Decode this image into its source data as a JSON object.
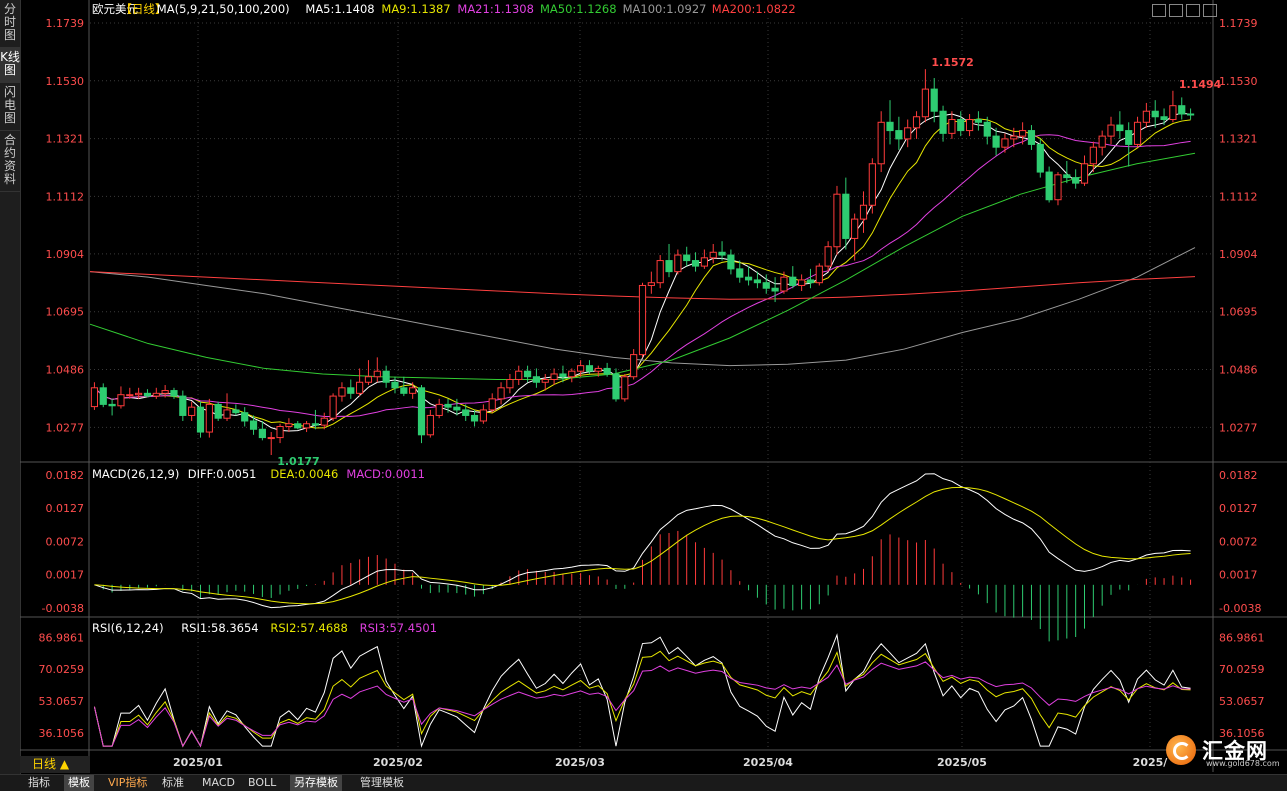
{
  "sidebar": [
    {
      "label": "分时图",
      "active": false
    },
    {
      "label": "K线图",
      "active": true
    },
    {
      "label": "闪电图",
      "active": false
    },
    {
      "label": "合约资料",
      "active": false
    }
  ],
  "main_legend": {
    "symbol": "欧元美元",
    "period": "【日线】",
    "icon": "gear-icon",
    "items": [
      {
        "text": "MA(5,9,21,50,100,200)",
        "color": "#ffffff"
      },
      {
        "text": "MA5:1.1408",
        "color": "#ffffff"
      },
      {
        "text": "MA9:1.1387",
        "color": "#e6e600"
      },
      {
        "text": "MA21:1.1308",
        "color": "#e040e0"
      },
      {
        "text": "MA50:1.1268",
        "color": "#33cc33"
      },
      {
        "text": "MA100:1.0927",
        "color": "#999999"
      },
      {
        "text": "MA200:1.0822",
        "color": "#ff4040"
      }
    ]
  },
  "price_axis": [
    "1.1739",
    "1.1530",
    "1.1321",
    "1.1112",
    "1.0904",
    "1.0695",
    "1.0486",
    "1.0277"
  ],
  "annotations": {
    "high": "1.1572",
    "low": "1.0177",
    "recent_high": "1.1494"
  },
  "macd_legend": [
    {
      "text": "MACD(26,12,9)",
      "color": "#ffffff"
    },
    {
      "text": "DIFF:0.0051",
      "color": "#ffffff"
    },
    {
      "text": "DEA:0.0046",
      "color": "#e6e600"
    },
    {
      "text": "MACD:0.0011",
      "color": "#e040e0"
    }
  ],
  "macd_axis": [
    "0.0182",
    "0.0127",
    "0.0072",
    "0.0017",
    "-0.0038"
  ],
  "rsi_legend": [
    {
      "text": "RSI(6,12,24)",
      "color": "#ffffff"
    },
    {
      "text": "RSI1:58.3654",
      "color": "#ffffff"
    },
    {
      "text": "RSI2:57.4688",
      "color": "#e6e600"
    },
    {
      "text": "RSI3:57.4501",
      "color": "#e040e0"
    }
  ],
  "rsi_axis": [
    "86.9861",
    "70.0259",
    "53.0657",
    "36.1056"
  ],
  "time_axis": [
    "2025/01",
    "2025/02",
    "2025/03",
    "2025/04",
    "2025/05",
    "2025/"
  ],
  "day_button": "日线 ▲",
  "bottom_tabs": [
    {
      "label": "指标",
      "style": "normal"
    },
    {
      "label": "模板",
      "style": "active"
    },
    {
      "label": "VIP指标",
      "style": "vip"
    },
    {
      "label": "标准",
      "style": "normal"
    },
    {
      "label": "MACD",
      "style": "normal"
    },
    {
      "label": "BOLL",
      "style": "normal"
    },
    {
      "label": "另存模板",
      "style": "active"
    },
    {
      "label": "管理模板",
      "style": "normal"
    }
  ],
  "logo": {
    "name": "汇金网",
    "url": "www.gold678.com"
  },
  "colors": {
    "up": "#ff3b3b",
    "down": "#2ecc71",
    "axis_text": "#ff4d4d",
    "grid": "#3a3a3a"
  },
  "chart_data": {
    "type": "candlestick",
    "period": "daily",
    "y_range": [
      1.0177,
      1.1739
    ],
    "extremes": {
      "high": 1.1572,
      "low": 1.0177,
      "recent_high": 1.1494
    },
    "ohlc": [
      [
        1.0352,
        1.044,
        1.034,
        1.042
      ],
      [
        1.042,
        1.0436,
        1.035,
        1.036
      ],
      [
        1.036,
        1.038,
        1.032,
        1.0355
      ],
      [
        1.0355,
        1.0425,
        1.0345,
        1.0395
      ],
      [
        1.0395,
        1.042,
        1.038,
        1.0395
      ],
      [
        1.0395,
        1.042,
        1.038,
        1.04
      ],
      [
        1.04,
        1.0415,
        1.0385,
        1.039
      ],
      [
        1.039,
        1.042,
        1.038,
        1.04
      ],
      [
        1.04,
        1.043,
        1.0385,
        1.041
      ],
      [
        1.041,
        1.042,
        1.038,
        1.039
      ],
      [
        1.039,
        1.041,
        1.03,
        1.032
      ],
      [
        1.032,
        1.037,
        1.03,
        1.035
      ],
      [
        1.035,
        1.037,
        1.024,
        1.026
      ],
      [
        1.026,
        1.038,
        1.024,
        1.036
      ],
      [
        1.036,
        1.037,
        1.03,
        1.031
      ],
      [
        1.031,
        1.04,
        1.03,
        1.034
      ],
      [
        1.034,
        1.036,
        1.032,
        1.033
      ],
      [
        1.033,
        1.035,
        1.028,
        1.03
      ],
      [
        1.03,
        1.032,
        1.025,
        1.027
      ],
      [
        1.027,
        1.03,
        1.023,
        1.024
      ],
      [
        1.024,
        1.026,
        1.0177,
        1.024
      ],
      [
        1.024,
        1.029,
        1.022,
        1.028
      ],
      [
        1.028,
        1.031,
        1.026,
        1.029
      ],
      [
        1.029,
        1.03,
        1.027,
        1.0275
      ],
      [
        1.0275,
        1.03,
        1.026,
        1.029
      ],
      [
        1.029,
        1.034,
        1.027,
        1.0285
      ],
      [
        1.0285,
        1.033,
        1.027,
        1.031
      ],
      [
        1.031,
        1.04,
        1.03,
        1.039
      ],
      [
        1.039,
        1.044,
        1.037,
        1.042
      ],
      [
        1.042,
        1.045,
        1.038,
        1.04
      ],
      [
        1.04,
        1.049,
        1.039,
        1.044
      ],
      [
        1.044,
        1.052,
        1.043,
        1.046
      ],
      [
        1.046,
        1.053,
        1.044,
        1.048
      ],
      [
        1.048,
        1.05,
        1.042,
        1.044
      ],
      [
        1.044,
        1.046,
        1.04,
        1.042
      ],
      [
        1.042,
        1.046,
        1.039,
        1.04
      ],
      [
        1.04,
        1.044,
        1.038,
        1.042
      ],
      [
        1.042,
        1.043,
        1.022,
        1.025
      ],
      [
        1.025,
        1.034,
        1.024,
        1.032
      ],
      [
        1.032,
        1.038,
        1.031,
        1.036
      ],
      [
        1.036,
        1.038,
        1.033,
        1.035
      ],
      [
        1.035,
        1.038,
        1.032,
        1.034
      ],
      [
        1.034,
        1.036,
        1.03,
        1.032
      ],
      [
        1.032,
        1.034,
        1.028,
        1.03
      ],
      [
        1.03,
        1.036,
        1.029,
        1.034
      ],
      [
        1.034,
        1.04,
        1.033,
        1.038
      ],
      [
        1.038,
        1.044,
        1.036,
        1.042
      ],
      [
        1.042,
        1.047,
        1.04,
        1.045
      ],
      [
        1.045,
        1.05,
        1.043,
        1.048
      ],
      [
        1.048,
        1.05,
        1.044,
        1.046
      ],
      [
        1.046,
        1.049,
        1.042,
        1.044
      ],
      [
        1.044,
        1.047,
        1.041,
        1.045
      ],
      [
        1.045,
        1.049,
        1.043,
        1.047
      ],
      [
        1.047,
        1.05,
        1.044,
        1.046
      ],
      [
        1.046,
        1.049,
        1.044,
        1.048
      ],
      [
        1.048,
        1.052,
        1.046,
        1.05
      ],
      [
        1.05,
        1.052,
        1.047,
        1.048
      ],
      [
        1.048,
        1.05,
        1.046,
        1.049
      ],
      [
        1.049,
        1.051,
        1.046,
        1.047
      ],
      [
        1.047,
        1.049,
        1.037,
        1.038
      ],
      [
        1.038,
        1.047,
        1.037,
        1.046
      ],
      [
        1.046,
        1.056,
        1.045,
        1.054
      ],
      [
        1.054,
        1.08,
        1.053,
        1.079
      ],
      [
        1.079,
        1.084,
        1.076,
        1.08
      ],
      [
        1.08,
        1.09,
        1.078,
        1.088
      ],
      [
        1.088,
        1.094,
        1.082,
        1.084
      ],
      [
        1.084,
        1.092,
        1.083,
        1.09
      ],
      [
        1.09,
        1.093,
        1.086,
        1.088
      ],
      [
        1.088,
        1.091,
        1.084,
        1.086
      ],
      [
        1.086,
        1.092,
        1.085,
        1.089
      ],
      [
        1.089,
        1.094,
        1.087,
        1.091
      ],
      [
        1.091,
        1.095,
        1.088,
        1.09
      ],
      [
        1.09,
        1.092,
        1.083,
        1.085
      ],
      [
        1.085,
        1.088,
        1.08,
        1.082
      ],
      [
        1.082,
        1.086,
        1.079,
        1.081
      ],
      [
        1.081,
        1.084,
        1.078,
        1.08
      ],
      [
        1.08,
        1.083,
        1.076,
        1.078
      ],
      [
        1.078,
        1.082,
        1.073,
        1.077
      ],
      [
        1.077,
        1.084,
        1.076,
        1.082
      ],
      [
        1.082,
        1.086,
        1.078,
        1.079
      ],
      [
        1.079,
        1.083,
        1.077,
        1.081
      ],
      [
        1.081,
        1.085,
        1.078,
        1.08
      ],
      [
        1.08,
        1.087,
        1.079,
        1.086
      ],
      [
        1.086,
        1.095,
        1.084,
        1.093
      ],
      [
        1.093,
        1.115,
        1.09,
        1.112
      ],
      [
        1.112,
        1.118,
        1.092,
        1.096
      ],
      [
        1.096,
        1.105,
        1.088,
        1.103
      ],
      [
        1.103,
        1.113,
        1.098,
        1.108
      ],
      [
        1.108,
        1.125,
        1.105,
        1.123
      ],
      [
        1.123,
        1.142,
        1.12,
        1.138
      ],
      [
        1.138,
        1.146,
        1.13,
        1.135
      ],
      [
        1.135,
        1.14,
        1.128,
        1.132
      ],
      [
        1.132,
        1.139,
        1.129,
        1.136
      ],
      [
        1.136,
        1.142,
        1.132,
        1.14
      ],
      [
        1.14,
        1.1572,
        1.138,
        1.15
      ],
      [
        1.15,
        1.154,
        1.138,
        1.142
      ],
      [
        1.142,
        1.144,
        1.131,
        1.134
      ],
      [
        1.134,
        1.142,
        1.132,
        1.139
      ],
      [
        1.139,
        1.142,
        1.133,
        1.135
      ],
      [
        1.135,
        1.141,
        1.133,
        1.139
      ],
      [
        1.139,
        1.142,
        1.135,
        1.138
      ],
      [
        1.138,
        1.14,
        1.13,
        1.133
      ],
      [
        1.133,
        1.136,
        1.126,
        1.129
      ],
      [
        1.129,
        1.134,
        1.127,
        1.132
      ],
      [
        1.132,
        1.136,
        1.129,
        1.133
      ],
      [
        1.133,
        1.138,
        1.13,
        1.135
      ],
      [
        1.135,
        1.137,
        1.128,
        1.13
      ],
      [
        1.13,
        1.132,
        1.118,
        1.12
      ],
      [
        1.12,
        1.122,
        1.109,
        1.11
      ],
      [
        1.11,
        1.12,
        1.108,
        1.119
      ],
      [
        1.119,
        1.124,
        1.116,
        1.118
      ],
      [
        1.118,
        1.121,
        1.114,
        1.116
      ],
      [
        1.116,
        1.126,
        1.115,
        1.123
      ],
      [
        1.123,
        1.131,
        1.12,
        1.129
      ],
      [
        1.129,
        1.135,
        1.126,
        1.133
      ],
      [
        1.133,
        1.14,
        1.13,
        1.137
      ],
      [
        1.137,
        1.142,
        1.132,
        1.135
      ],
      [
        1.135,
        1.138,
        1.122,
        1.13
      ],
      [
        1.13,
        1.14,
        1.129,
        1.138
      ],
      [
        1.138,
        1.145,
        1.136,
        1.142
      ],
      [
        1.142,
        1.146,
        1.136,
        1.14
      ],
      [
        1.14,
        1.143,
        1.137,
        1.139
      ],
      [
        1.139,
        1.1494,
        1.138,
        1.144
      ],
      [
        1.144,
        1.147,
        1.139,
        1.141
      ],
      [
        1.141,
        1.143,
        1.139,
        1.1408
      ]
    ],
    "moving_averages": [
      {
        "name": "MA100",
        "values": [
          1.084,
          1.082,
          1.079,
          1.076,
          1.072,
          1.068,
          1.064,
          1.06,
          1.056,
          1.053,
          1.051,
          1.05,
          1.0505,
          1.052,
          1.056,
          1.062,
          1.067,
          1.074,
          1.082,
          1.0927
        ]
      },
      {
        "name": "MA200",
        "values": [
          1.084,
          1.083,
          1.082,
          1.081,
          1.08,
          1.079,
          1.078,
          1.077,
          1.076,
          1.0752,
          1.0745,
          1.074,
          1.0742,
          1.0748,
          1.0758,
          1.077,
          1.0785,
          1.08,
          1.0812,
          1.0822
        ]
      },
      {
        "name": "MA50",
        "values": [
          1.065,
          1.058,
          1.053,
          1.049,
          1.047,
          1.046,
          1.0455,
          1.045,
          1.045,
          1.047,
          1.052,
          1.06,
          1.07,
          1.081,
          1.093,
          1.104,
          1.112,
          1.118,
          1.123,
          1.1268
        ]
      }
    ],
    "macd": {
      "diff": 0.0051,
      "dea": 0.0046,
      "macd": 0.0011,
      "y_range": [
        -0.0038,
        0.0182
      ]
    },
    "rsi": {
      "rsi1": 58.3654,
      "rsi2": 57.4688,
      "rsi3": 57.4501,
      "y_range": [
        36.1056,
        86.9861
      ]
    }
  }
}
